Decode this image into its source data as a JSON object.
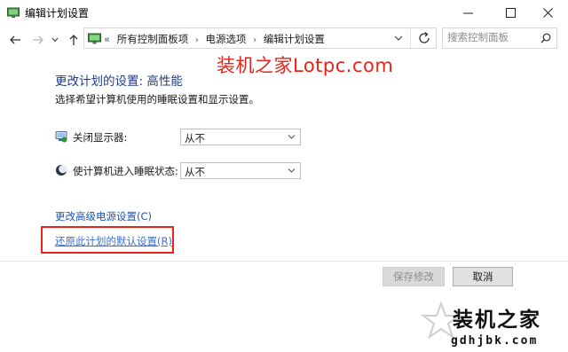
{
  "window": {
    "title": "编辑计划设置"
  },
  "address_bar": {
    "overflow_marker": "«",
    "crumbs": [
      "所有控制面板项",
      "电源选项",
      "编辑计划设置"
    ]
  },
  "search": {
    "placeholder": "搜索控制面板"
  },
  "watermark_top": "装机之家Lotpc.com",
  "main": {
    "title": "更改计划的设置: 高性能",
    "description": "选择希望计算机使用的睡眠设置和显示设置。",
    "settings": [
      {
        "label": "关闭显示器:",
        "value": "从不",
        "icon": "monitor-icon"
      },
      {
        "label": "使计算机进入睡眠状态:",
        "value": "从不",
        "icon": "sleep-moon-icon"
      }
    ],
    "links": {
      "advanced": "更改高级电源设置(C)",
      "restore": "还原此计划的默认设置(R)"
    }
  },
  "footer": {
    "save_label": "保存修改",
    "cancel_label": "取消"
  },
  "brand": {
    "name": "装机之家",
    "url": "gdhjbk.com"
  },
  "colors": {
    "title_blue": "#1e3a8a",
    "link_blue": "#1a56b4",
    "highlight_red": "#e8231a"
  }
}
